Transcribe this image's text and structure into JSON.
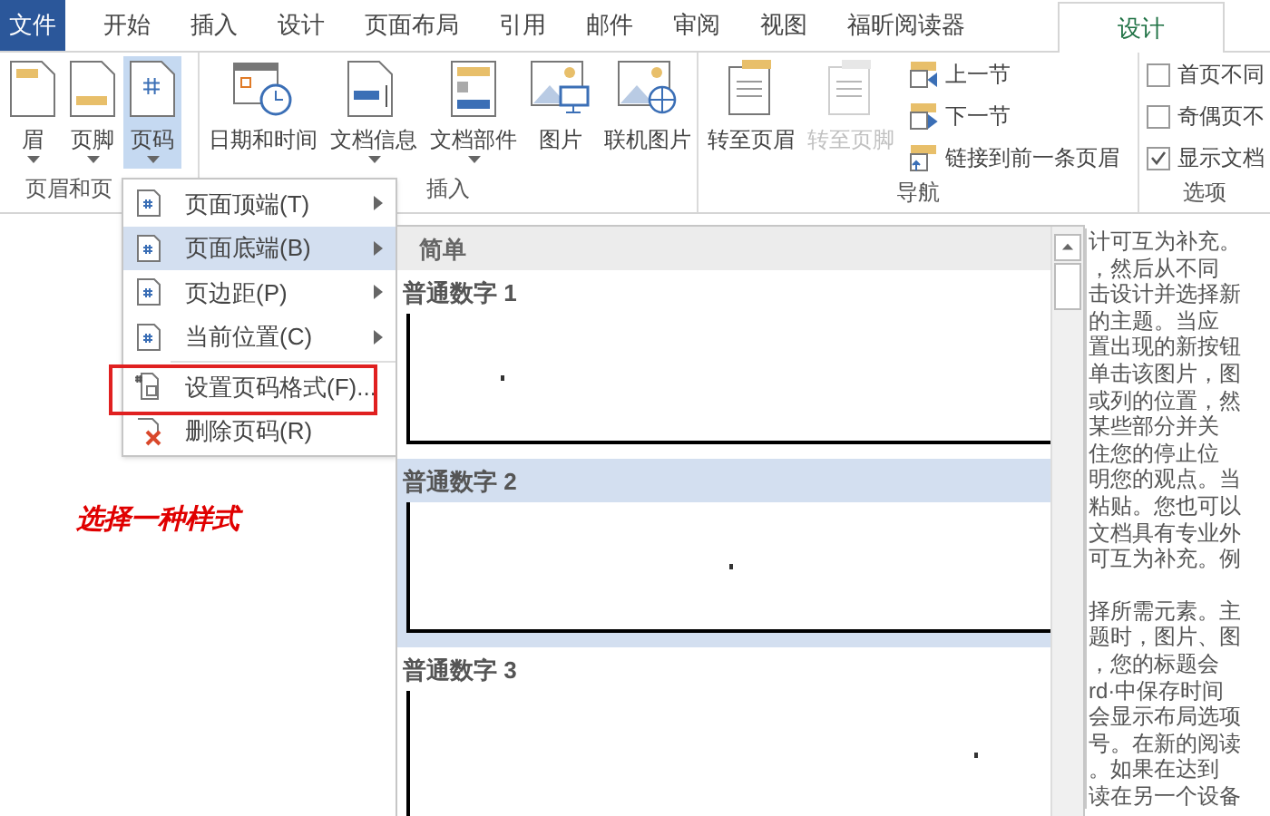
{
  "tabs": [
    {
      "label": "文件",
      "kind": "file",
      "selected": false
    },
    {
      "label": "开始",
      "kind": "tab",
      "selected": false
    },
    {
      "label": "插入",
      "kind": "tab",
      "selected": false
    },
    {
      "label": "设计",
      "kind": "tab",
      "selected": false
    },
    {
      "label": "页面布局",
      "kind": "tab",
      "selected": false
    },
    {
      "label": "引用",
      "kind": "tab",
      "selected": false
    },
    {
      "label": "邮件",
      "kind": "tab",
      "selected": false
    },
    {
      "label": "审阅",
      "kind": "tab",
      "selected": false
    },
    {
      "label": "视图",
      "kind": "tab",
      "selected": false
    },
    {
      "label": "福昕阅读器",
      "kind": "tab",
      "selected": false
    },
    {
      "label": "设计",
      "kind": "tab",
      "selected": true
    }
  ],
  "ribbon": {
    "groups": [
      {
        "label": "页眉和页",
        "buttons": [
          {
            "label": "眉",
            "dropdown": true,
            "selected": false
          },
          {
            "label": "页脚",
            "dropdown": true,
            "selected": false
          },
          {
            "label": "页码",
            "dropdown": true,
            "selected": true
          }
        ]
      },
      {
        "label": "插入",
        "buttons": [
          {
            "label": "日期和时间",
            "dropdown": false,
            "selected": false
          },
          {
            "label": "文档信息",
            "dropdown": true,
            "selected": false
          },
          {
            "label": "文档部件",
            "dropdown": true,
            "selected": false
          },
          {
            "label": "图片",
            "dropdown": false,
            "selected": false
          },
          {
            "label": "联机图片",
            "dropdown": false,
            "selected": false
          }
        ]
      },
      {
        "label": "导航",
        "buttons": [
          {
            "label": "转至页眉",
            "disabled": false
          },
          {
            "label": "转至页脚",
            "disabled": true
          }
        ],
        "small_buttons": [
          "上一节",
          "下一节",
          "链接到前一条页眉"
        ]
      },
      {
        "label": "选项",
        "checkboxes": [
          {
            "label": "首页不同",
            "checked": false
          },
          {
            "label": "奇偶页不",
            "checked": false
          },
          {
            "label": "显示文档",
            "checked": true
          }
        ]
      }
    ]
  },
  "page_number_menu": [
    {
      "label": "页面顶端(T)",
      "submenu": true,
      "selected": false,
      "highlighted": false
    },
    {
      "label": "页面底端(B)",
      "submenu": true,
      "selected": true,
      "highlighted": false
    },
    {
      "label": "页边距(P)",
      "submenu": true,
      "selected": false,
      "highlighted": false
    },
    {
      "label": "当前位置(C)",
      "submenu": true,
      "selected": false,
      "highlighted": false
    },
    {
      "label": "设置页码格式(F)...",
      "submenu": false,
      "selected": false,
      "highlighted": true
    },
    {
      "label": "删除页码(R)",
      "submenu": false,
      "selected": false,
      "highlighted": false
    }
  ],
  "gallery": {
    "header": "简单",
    "items": [
      {
        "label": "普通数字 1",
        "selected": false
      },
      {
        "label": "普通数字 2",
        "selected": true
      },
      {
        "label": "普通数字 3",
        "selected": false
      }
    ]
  },
  "annotation": "选择一种样式",
  "document_paragraphs": [
    [
      "计可互为补充。",
      "，然后从不同",
      "击设计并选择新",
      "的主题。当应",
      "置出现的新按钮",
      "单击该图片，图",
      "或列的位置，然",
      "某些部分并关",
      "住您的停止位",
      "明您的观点。当",
      "粘贴。您也可以",
      "文档具有专业外",
      "可互为补充。例"
    ],
    [
      "择所需元素。主",
      "题时，图片、图",
      "，您的标题会",
      "rd·中保存时间",
      "会显示布局选项",
      "号。在新的阅读",
      "。如果在达到",
      "读在另一个设备"
    ]
  ]
}
